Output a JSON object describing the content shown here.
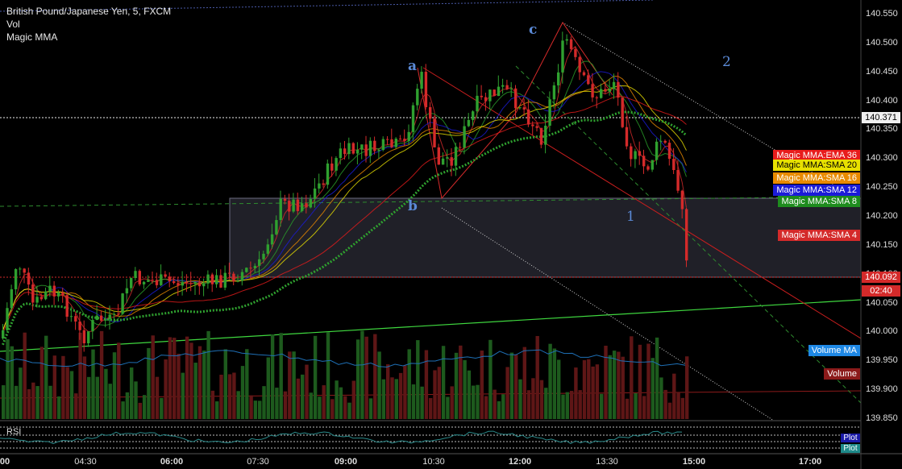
{
  "legend": {
    "symbol": "British Pound/Japanese Yen, 5, FXCM",
    "vol": "Vol",
    "indicator": "Magic MMA"
  },
  "price_axis": {
    "ticks": [
      "140.550",
      "140.500",
      "140.450",
      "140.400",
      "140.350",
      "140.300",
      "140.250",
      "140.200",
      "140.150",
      "140.100",
      "140.050",
      "140.000",
      "139.950",
      "139.900",
      "139.850"
    ],
    "highlight_level": "140.371",
    "current_price": "140.092",
    "countdown": "02:40"
  },
  "time_axis": {
    "ticks": [
      {
        "label": "00",
        "bold": true
      },
      {
        "label": "04:30",
        "bold": false
      },
      {
        "label": "06:00",
        "bold": true
      },
      {
        "label": "07:30",
        "bold": false
      },
      {
        "label": "09:00",
        "bold": true
      },
      {
        "label": "10:30",
        "bold": false
      },
      {
        "label": "12:00",
        "bold": true
      },
      {
        "label": "13:30",
        "bold": false
      },
      {
        "label": "15:00",
        "bold": true
      },
      {
        "label": "17:00",
        "bold": true
      }
    ]
  },
  "ma_labels": [
    {
      "text": "Magic MMA:EMA 36",
      "color": "#e81c1c"
    },
    {
      "text": "Magic MMA:SMA 20",
      "color": "#e8e000"
    },
    {
      "text": "Magic MMA:SMA 16",
      "color": "#e98a00"
    },
    {
      "text": "Magic MMA:SMA 12",
      "color": "#1b1bd8"
    },
    {
      "text": "Magic MMA:SMA 8",
      "color": "#1e8c1e"
    },
    {
      "text": "Magic MMA:SMA 4",
      "color": "#d42a2a"
    }
  ],
  "volume_labels": {
    "volume_ma": "Volume MA",
    "volume": "Volume"
  },
  "annotations": [
    "a",
    "b",
    "c",
    "1",
    "2"
  ],
  "rsi": {
    "label": "RSI",
    "plot1": "Plot",
    "plot2": "Plot"
  },
  "colors": {
    "background": "#000000",
    "bull_candle": "#2fa02f",
    "bear_candle": "#d42a2a",
    "volume_ma": "#1e88e5",
    "volume": "#8b1a1a",
    "price_box": "#d42a2a",
    "level_box": "#f0f0f0",
    "annotation": "#5b8ad6"
  }
}
